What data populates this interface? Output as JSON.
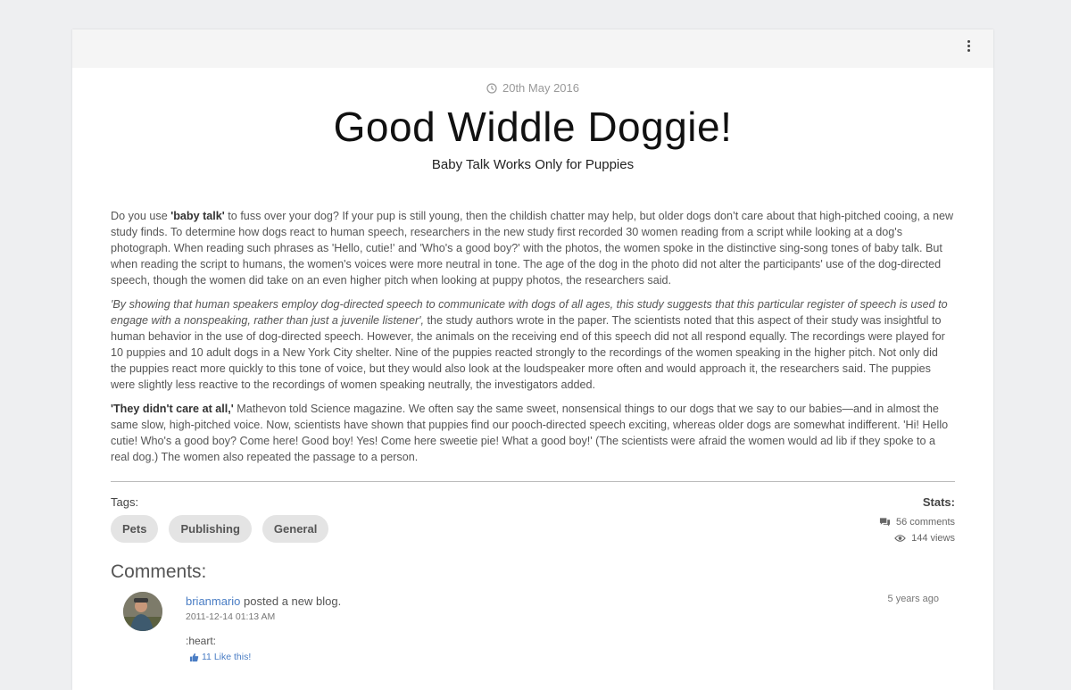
{
  "post": {
    "date": "20th May 2016",
    "title": "Good Widdle Doggie!",
    "subtitle": "Baby Talk Works Only for Puppies",
    "p1_pre": "Do you use ",
    "p1_bold": "'baby talk'",
    "p1_post": " to fuss over your dog? If your pup is still young, then the childish chatter may help, but older dogs don’t care about that high-pitched cooing, a new study finds. To determine how dogs react to human speech, researchers in the new study first recorded 30 women reading from a script while looking at a dog's photograph. When reading such phrases as 'Hello, cutie!' and 'Who's a good boy?' with the photos, the women spoke in the distinctive sing-song tones of baby talk. But when reading the script to humans, the women's voices were more neutral in tone. The age of the dog in the photo did not alter the participants' use of the dog-directed speech, though the women did take on an even higher pitch when looking at puppy photos, the researchers said.",
    "p2_italic": "'By showing that human speakers employ dog-directed speech to communicate with dogs of all ages, this study suggests that this particular register of speech is used to engage with a nonspeaking, rather than just a juvenile listener',",
    "p2_post": " the study authors wrote in the paper. The scientists noted that this aspect of their study was insightful to human behavior in the use of dog-directed speech. However, the animals on the receiving end of this speech did not all respond equally. The recordings were played for 10 puppies and 10 adult dogs in a New York City shelter. Nine of the puppies reacted strongly to the recordings of the women speaking in the higher pitch. Not only did the puppies react more quickly to this tone of voice, but they would also look at the loudspeaker more often and would approach it, the researchers said. The puppies were slightly less reactive to the recordings of women speaking neutrally, the investigators added.",
    "p3_bold": "'They didn't care at all,'",
    "p3_post": " Mathevon told Science magazine. We often say the same sweet, nonsensical things to our dogs that we say to our babies—and in almost the same slow, high-pitched voice. Now, scientists have shown that puppies find our pooch-directed speech exciting, whereas older dogs are somewhat indifferent. 'Hi! Hello cutie! Who's a good boy? Come here! Good boy! Yes! Come here sweetie pie! What a good boy!' (The scientists were afraid the women would ad lib if they spoke to a real dog.) The women also repeated the passage to a person."
  },
  "tags": {
    "label": "Tags:",
    "items": [
      "Pets",
      "Publishing",
      "General"
    ]
  },
  "stats": {
    "label": "Stats:",
    "comments": "56 comments",
    "views": "144 views"
  },
  "comments": {
    "heading": "Comments:",
    "items": [
      {
        "user": "brianmario",
        "action": "posted a new blog.",
        "timestamp": "2011-12-14 01:13 AM",
        "ago": "5 years ago",
        "text": ":heart:",
        "likes": "11 Like this!"
      }
    ]
  }
}
